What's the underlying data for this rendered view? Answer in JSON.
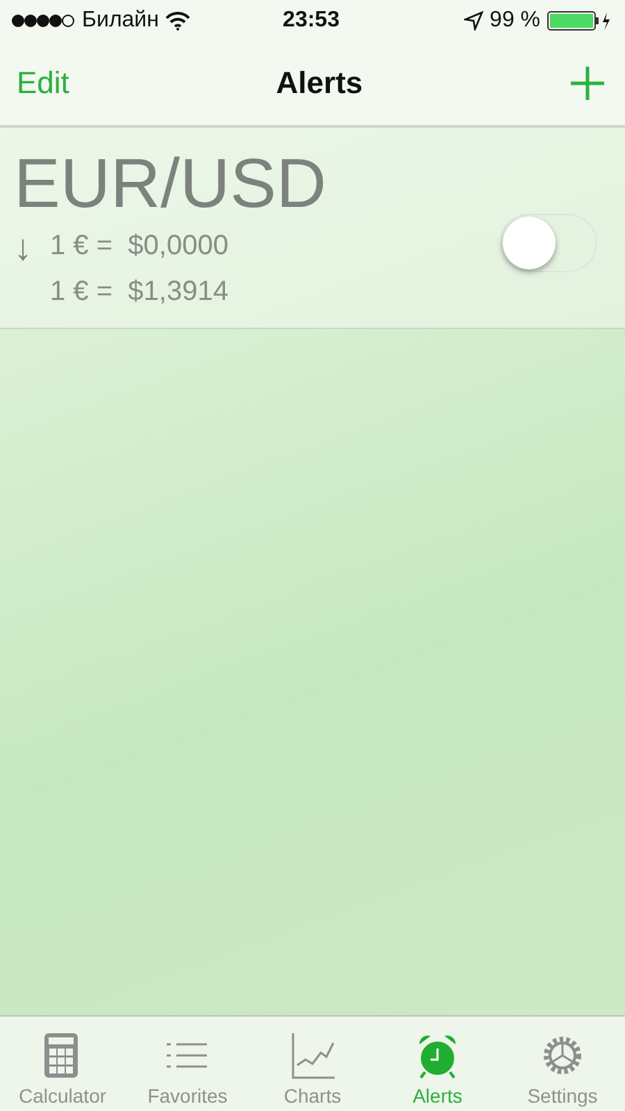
{
  "status_bar": {
    "carrier": "Билайн",
    "time": "23:53",
    "battery": "99 %"
  },
  "nav_bar": {
    "left": "Edit",
    "title": "Alerts"
  },
  "alerts": [
    {
      "pair": "EUR/USD",
      "arrow": "↓",
      "lines": [
        "1 € =  $0,0000",
        "1 € =  $1,3914"
      ],
      "on": false
    }
  ],
  "tab_bar": [
    {
      "label": "Calculator",
      "kind": "calculator",
      "selected": false
    },
    {
      "label": "Favorites",
      "kind": "list",
      "selected": false
    },
    {
      "label": "Charts",
      "kind": "chart",
      "selected": false
    },
    {
      "label": "Alerts",
      "kind": "alarm",
      "selected": true
    },
    {
      "label": "Settings",
      "kind": "gear",
      "selected": false
    }
  ]
}
